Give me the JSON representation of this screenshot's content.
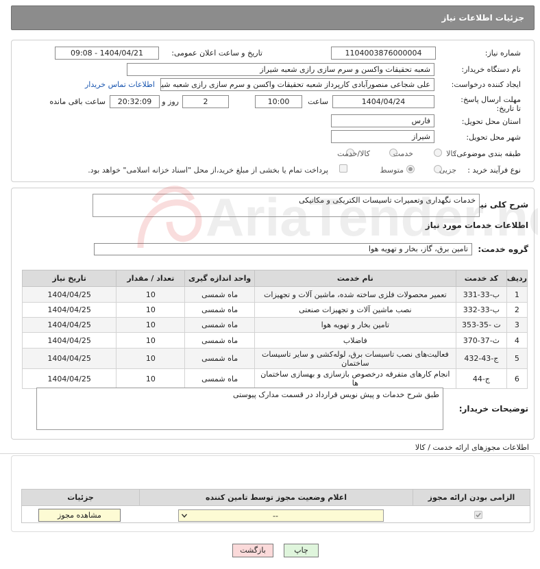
{
  "header": {
    "title": "جزئیات اطلاعات نیاز"
  },
  "form": {
    "need_number_label": "شماره نیاز:",
    "need_number": "1104003876000004",
    "announce_label": "تاریخ و ساعت اعلان عمومی:",
    "announce_value": "1404/04/21 - 09:08",
    "buyer_org_label": "نام دستگاه خریدار:",
    "buyer_org": "شعبه تحقیقات واکسن و سرم سازی رازی  شعبه شیراز",
    "creator_label": "ایجاد کننده درخواست:",
    "creator": "علی شجاعی منصورآبادی کارپرداز شعبه تحقیقات واکسن و سرم سازی رازی  شعبه شیراز",
    "buyer_contact_link": "اطلاعات تماس خریدار",
    "deadline_label": "مهلت ارسال پاسخ: تا تاریخ:",
    "deadline_date": "1404/04/24",
    "time_label": "ساعت",
    "deadline_time": "10:00",
    "days_value": "2",
    "days_label": "روز و",
    "remaining_time": "20:32:09",
    "remaining_label": "ساعت باقی مانده",
    "province_label": "استان محل تحویل:",
    "province": "فارس",
    "city_label": "شهر محل تحویل:",
    "city": "شیراز",
    "category_label": "طبقه بندی موضوعی:",
    "category_options": [
      "کالا",
      "خدمت",
      "کالا/خدمت"
    ],
    "process_label": "نوع فرآیند خرید :",
    "process_options": [
      "جزیی",
      "متوسط"
    ],
    "payment_text": "پرداخت تمام یا بخشی از مبلغ خرید،از محل \"اسناد خزانه اسلامی\" خواهد بود."
  },
  "summary": {
    "label": "شرح کلی نیاز:",
    "value": "خدمات نگهداری وتعمیرات تاسیسات الکتریکی و مکانیکی",
    "services_title": "اطلاعات خدمات مورد نیاز",
    "group_label": "گروه خدمت:",
    "group_value": "تامین برق، گاز، بخار و تهویه هوا"
  },
  "services_table": {
    "headers": [
      "ردیف",
      "کد خدمت",
      "نام خدمت",
      "واحد اندازه گیری",
      "تعداد / مقدار",
      "تاریخ نیاز"
    ],
    "rows": [
      [
        "1",
        "ب-33-331",
        "تعمیر محصولات فلزی ساخته شده، ماشین آلات و تجهیزات",
        "ماه شمسی",
        "10",
        "1404/04/25"
      ],
      [
        "2",
        "ب-33-332",
        "نصب ماشین آلات و تجهیزات صنعتی",
        "ماه شمسی",
        "10",
        "1404/04/25"
      ],
      [
        "3",
        "ت -35-353",
        "تامین بخار و تهویه هوا",
        "ماه شمسی",
        "10",
        "1404/04/25"
      ],
      [
        "4",
        "ث-37-370",
        "فاضلاب",
        "ماه شمسی",
        "10",
        "1404/04/25"
      ],
      [
        "5",
        "ج-43-432",
        "فعالیت‌های نصب تاسیسات برق، لوله‌کشی و سایر تاسیسات ساختمان",
        "ماه شمسی",
        "10",
        "1404/04/25"
      ],
      [
        "6",
        "ج-44",
        "انجام کارهای متفرقه درخصوص بازسازی و بهسازی ساختمان ها",
        "ماه شمسی",
        "10",
        "1404/04/25"
      ]
    ]
  },
  "buyer_notes": {
    "label": "توضیحات خریدار:",
    "value": "طبق شرح خدمات و پیش نویس قرارداد در قسمت مدارک پیوستی"
  },
  "permits": {
    "title": "اطلاعات مجوزهای ارائه خدمت / کالا",
    "headers": [
      "الزامی بودن ارائه مجوز",
      "اعلام وضعیت مجوز توسط تامین کننده",
      "جزئیات"
    ],
    "select_value": "--",
    "view_button": "مشاهده مجوز"
  },
  "actions": {
    "print": "چاپ",
    "back": "بازگشت"
  },
  "watermark": {
    "text": "AriaTender.neT"
  },
  "colors": {
    "header_bg": "#8c8c8c",
    "link": "#1a56b0",
    "print_bg": "#dff5dc",
    "back_bg": "#fbdada",
    "view_bg": "#fdfbd4"
  }
}
